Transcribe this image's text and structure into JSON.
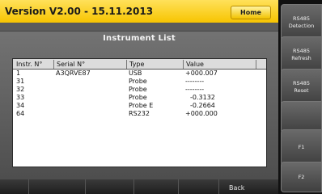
{
  "header": {
    "version": "Version V2.00 - 15.11.2013",
    "home_label": "Home"
  },
  "list_title": "Instrument List",
  "table": {
    "columns": [
      "Instr. N°",
      "Serial  N°",
      "Type",
      "Value"
    ],
    "rows": [
      [
        "1",
        "A3QRVE87",
        "USB",
        "+000.007"
      ],
      [
        "31",
        "",
        "Probe",
        "--------"
      ],
      [
        "32",
        "",
        "Probe",
        "--------"
      ],
      [
        "33",
        "",
        "Probe",
        "-0.3132"
      ],
      [
        "34",
        "",
        "Probe  E",
        "-0.2664"
      ],
      [
        "64",
        "",
        "RS232",
        "+000.000"
      ]
    ]
  },
  "bottom": {
    "back_label": "Back"
  },
  "side_buttons": [
    {
      "line1": "RS485",
      "line2": "Detection"
    },
    {
      "line1": "RS485",
      "line2": "Refresh"
    },
    {
      "line1": "RS485",
      "line2": "Reset"
    },
    {
      "line1": "",
      "line2": ""
    },
    {
      "line1": "F1",
      "line2": ""
    },
    {
      "line1": "F2",
      "line2": ""
    }
  ]
}
